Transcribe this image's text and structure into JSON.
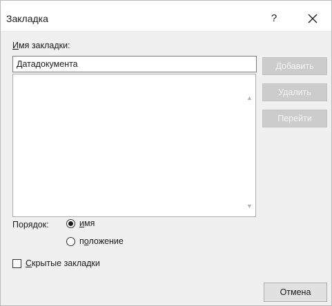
{
  "window": {
    "title": "Закладка",
    "help_label": "?",
    "close_icon": "close-icon"
  },
  "bookmark_name": {
    "label_underlined": "И",
    "label_rest": "мя закладки:",
    "value": "Датадокумента"
  },
  "buttons": {
    "add": "Добавить",
    "delete": "Удалить",
    "goto": "Перейти",
    "cancel": "Отмена"
  },
  "order": {
    "label": "Порядок:",
    "options": [
      {
        "pre": "",
        "underlined": "и",
        "post": "мя",
        "checked": true
      },
      {
        "pre": "п",
        "underlined": "о",
        "post": "ложение",
        "checked": false
      }
    ]
  },
  "hidden": {
    "underlined": "С",
    "rest": "крытые закладки",
    "checked": false
  },
  "colors": {
    "dialog_bg": "#f0f0f0",
    "disabled_button_bg": "#cccccc",
    "disabled_button_text": "#f5f5f5"
  }
}
